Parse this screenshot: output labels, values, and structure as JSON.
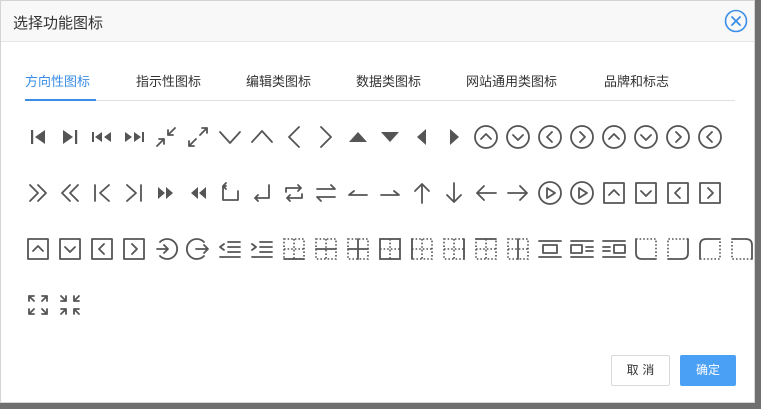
{
  "dialog": {
    "title": "选择功能图标"
  },
  "tabs": [
    {
      "label": "方向性图标",
      "active": true
    },
    {
      "label": "指示性图标",
      "active": false
    },
    {
      "label": "编辑类图标",
      "active": false
    },
    {
      "label": "数据类图标",
      "active": false
    },
    {
      "label": "网站通用类图标",
      "active": false
    },
    {
      "label": "品牌和标志",
      "active": false
    }
  ],
  "icons": [
    "step-backward-icon",
    "step-forward-icon",
    "fast-backward-icon",
    "fast-forward-icon",
    "shrink-icon",
    "arrows-alt-icon",
    "down-icon",
    "up-icon",
    "left-icon",
    "right-icon",
    "caret-up-icon",
    "caret-down-icon",
    "caret-left-icon",
    "caret-right-icon",
    "up-circle-icon",
    "down-circle-icon",
    "left-circle-icon",
    "right-circle-icon",
    "up-circle-outline-icon",
    "down-circle-outline-icon",
    "right-circle-outline-icon",
    "left-circle-outline-icon",
    "double-right-icon",
    "double-left-icon",
    "vertical-left-icon",
    "vertical-right-icon",
    "forward-icon",
    "backward-icon",
    "rollback-icon",
    "enter-icon",
    "retweet-icon",
    "swap-icon",
    "swap-left-icon",
    "swap-right-icon",
    "arrow-up-icon",
    "arrow-down-icon",
    "arrow-left-icon",
    "arrow-right-icon",
    "play-circle-icon",
    "play-circle-outline-icon",
    "up-square-icon",
    "down-square-icon",
    "left-square-icon",
    "right-square-icon",
    "up-square-outline-icon",
    "down-square-outline-icon",
    "left-square-outline-icon",
    "right-square-outline-icon",
    "login-icon",
    "logout-icon",
    "menu-fold-icon",
    "menu-unfold-icon",
    "border-bottom-icon",
    "border-horizontal-icon",
    "border-inner-icon",
    "border-outer-icon",
    "border-left-icon",
    "border-right-icon",
    "border-top-icon",
    "border-verticle-icon",
    "pic-center-icon",
    "pic-left-icon",
    "pic-right-icon",
    "radius-bottomleft-icon",
    "radius-bottomright-icon",
    "radius-upleft-icon",
    "radius-upright-icon",
    "fullscreen-icon",
    "fullscreen-exit-icon"
  ],
  "footer": {
    "cancel_label": "取 消",
    "ok_label": "确定"
  },
  "colors": {
    "accent": "#3a8ee6",
    "primary_button": "#4aa0f4",
    "icon": "#555555"
  }
}
